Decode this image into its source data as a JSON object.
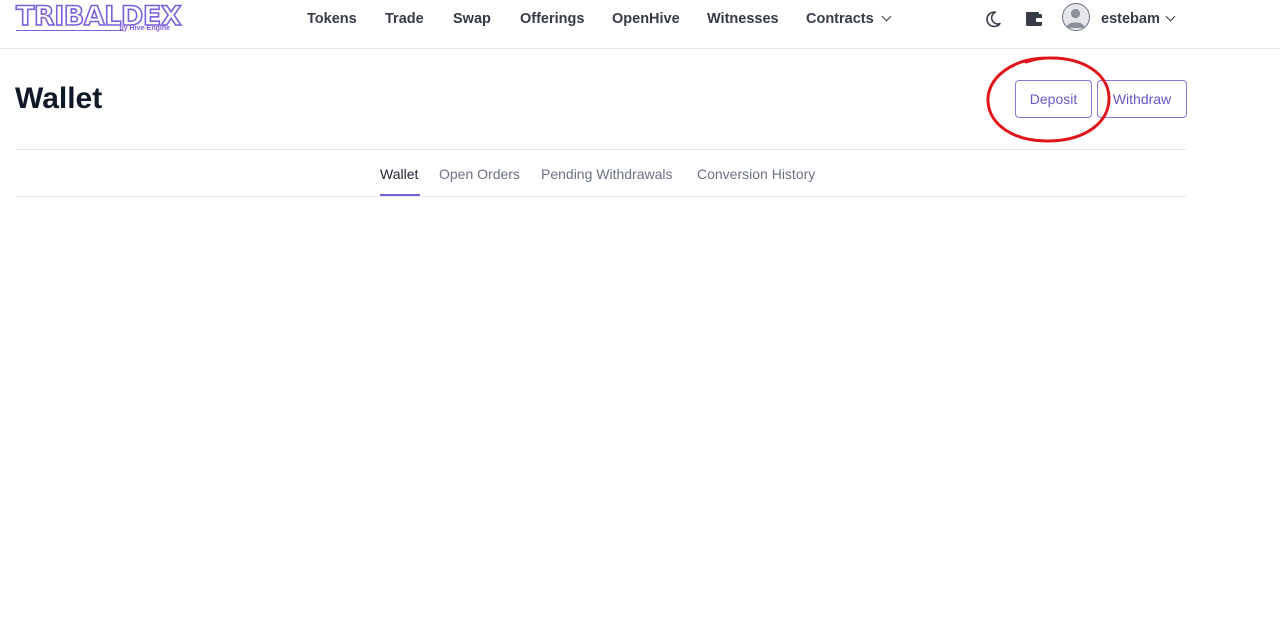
{
  "brand": {
    "name": "TRIBALDEX",
    "tagline": "by Hive-Engine",
    "accent_color": "#7b61d9"
  },
  "nav": {
    "items": [
      {
        "label": "Tokens"
      },
      {
        "label": "Trade"
      },
      {
        "label": "Swap"
      },
      {
        "label": "Offerings"
      },
      {
        "label": "OpenHive"
      },
      {
        "label": "Witnesses"
      },
      {
        "label": "Contracts",
        "icon": "chevron-down-icon"
      }
    ]
  },
  "header_icons": {
    "theme_toggle": "moon-icon",
    "wallet": "wallet-icon",
    "avatar": "user-avatar-icon"
  },
  "user": {
    "username": "estebam"
  },
  "page": {
    "title": "Wallet",
    "actions": {
      "deposit_label": "Deposit",
      "withdraw_label": "Withdraw"
    },
    "annotation": {
      "shape": "ellipse",
      "color": "#e0151b",
      "target": "deposit-button"
    },
    "tabs": [
      {
        "label": "Wallet",
        "active": true
      },
      {
        "label": "Open Orders",
        "active": false
      },
      {
        "label": "Pending Withdrawals",
        "active": false
      },
      {
        "label": "Conversion History",
        "active": false
      }
    ]
  }
}
